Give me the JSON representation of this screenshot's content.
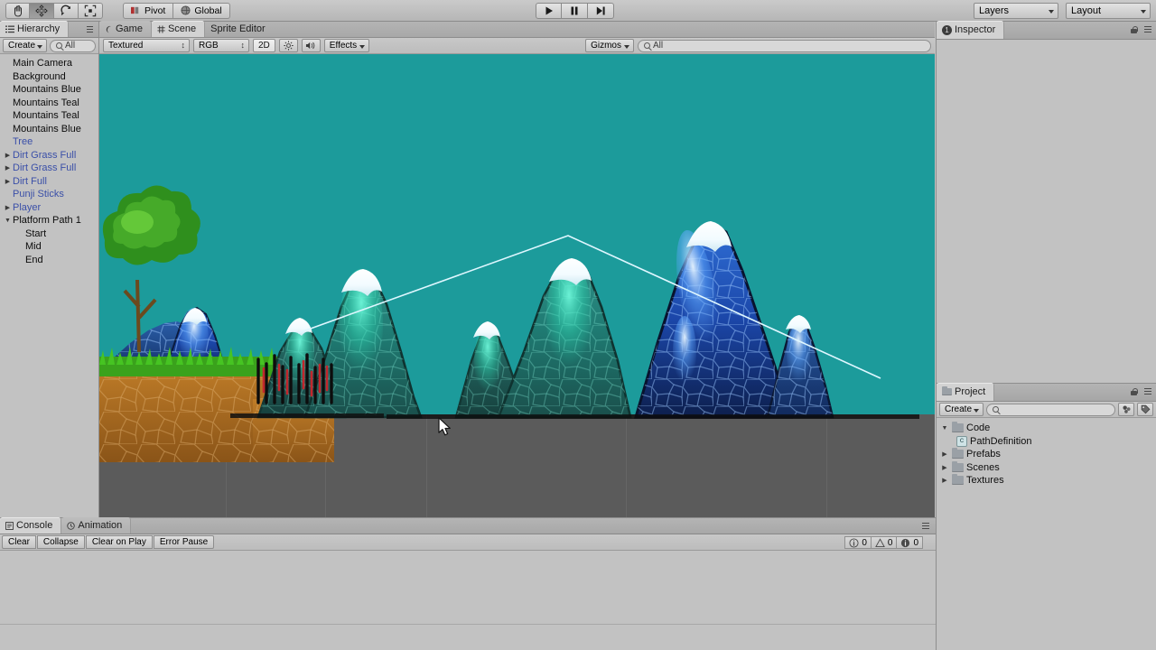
{
  "app": {
    "title": "Unity Editor"
  },
  "toolbar": {
    "tools": [
      {
        "name": "hand-tool",
        "icon": "hand",
        "active": false
      },
      {
        "name": "move-tool",
        "icon": "move",
        "active": true
      },
      {
        "name": "rotate-tool",
        "icon": "rotate",
        "active": false
      },
      {
        "name": "scale-tool",
        "icon": "scale",
        "active": false
      }
    ],
    "pivot_label": "Pivot",
    "global_label": "Global",
    "play_label": "Play",
    "pause_label": "Pause",
    "step_label": "Step",
    "layers_label": "Layers",
    "layout_label": "Layout"
  },
  "hierarchy": {
    "tab_label": "Hierarchy",
    "create_label": "Create",
    "search_placeholder": "All",
    "search_value": "",
    "items": [
      {
        "label": "Main Camera",
        "indent": 0,
        "fold": "",
        "prefab": false
      },
      {
        "label": "Background",
        "indent": 0,
        "fold": "",
        "prefab": false
      },
      {
        "label": "Mountains Blue",
        "indent": 0,
        "fold": "",
        "prefab": false
      },
      {
        "label": "Mountains Teal",
        "indent": 0,
        "fold": "",
        "prefab": false
      },
      {
        "label": "Mountains Teal",
        "indent": 0,
        "fold": "",
        "prefab": false
      },
      {
        "label": "Mountains Blue",
        "indent": 0,
        "fold": "",
        "prefab": false
      },
      {
        "label": "Tree",
        "indent": 0,
        "fold": "",
        "prefab": true
      },
      {
        "label": "Dirt Grass Full",
        "indent": 0,
        "fold": "right",
        "prefab": true
      },
      {
        "label": "Dirt Grass Full",
        "indent": 0,
        "fold": "right",
        "prefab": true
      },
      {
        "label": "Dirt Full",
        "indent": 0,
        "fold": "right",
        "prefab": true
      },
      {
        "label": "Punji Sticks",
        "indent": 0,
        "fold": "",
        "prefab": true
      },
      {
        "label": "Player",
        "indent": 0,
        "fold": "right",
        "prefab": true
      },
      {
        "label": "Platform Path 1",
        "indent": 0,
        "fold": "down",
        "prefab": false
      },
      {
        "label": "Start",
        "indent": 1,
        "fold": "",
        "prefab": false
      },
      {
        "label": "Mid",
        "indent": 1,
        "fold": "",
        "prefab": false
      },
      {
        "label": "End",
        "indent": 1,
        "fold": "",
        "prefab": false
      }
    ]
  },
  "scene": {
    "tabs": [
      {
        "label": "Game",
        "icon": "game-icon",
        "active": false
      },
      {
        "label": "Scene",
        "icon": "scene-icon",
        "active": true
      },
      {
        "label": "Sprite Editor",
        "icon": "",
        "active": false
      }
    ],
    "draw_mode": "Textured",
    "color_mode": "RGB",
    "mode_2d": "2D",
    "lighting_label": "light-toggle",
    "audio_label": "audio-toggle",
    "effects_label": "Effects",
    "gizmos_label": "Gizmos",
    "search_placeholder": "All",
    "search_value": "",
    "sky_color": "#1c9b9b",
    "ground_color": "#5b5b5b",
    "path_color": "#d8f7ff"
  },
  "inspector": {
    "tab_label": "Inspector",
    "badge": "1"
  },
  "project": {
    "tab_label": "Project",
    "create_label": "Create",
    "search_placeholder": "",
    "search_value": "",
    "items": [
      {
        "label": "Code",
        "type": "folder",
        "fold": "down",
        "indent": 0
      },
      {
        "label": "PathDefinition",
        "type": "script",
        "fold": "",
        "indent": 1
      },
      {
        "label": "Prefabs",
        "type": "folder",
        "fold": "right",
        "indent": 0
      },
      {
        "label": "Scenes",
        "type": "folder",
        "fold": "right",
        "indent": 0
      },
      {
        "label": "Textures",
        "type": "folder",
        "fold": "right",
        "indent": 0
      }
    ]
  },
  "console": {
    "tabs": [
      {
        "label": "Console",
        "active": true
      },
      {
        "label": "Animation",
        "active": false
      }
    ],
    "buttons": [
      {
        "label": "Clear",
        "pressed": false
      },
      {
        "label": "Collapse",
        "pressed": false
      },
      {
        "label": "Clear on Play",
        "pressed": false
      },
      {
        "label": "Error Pause",
        "pressed": false
      }
    ],
    "counts": {
      "log": "0",
      "warning": "0",
      "error": "0"
    }
  },
  "chart_data": null
}
